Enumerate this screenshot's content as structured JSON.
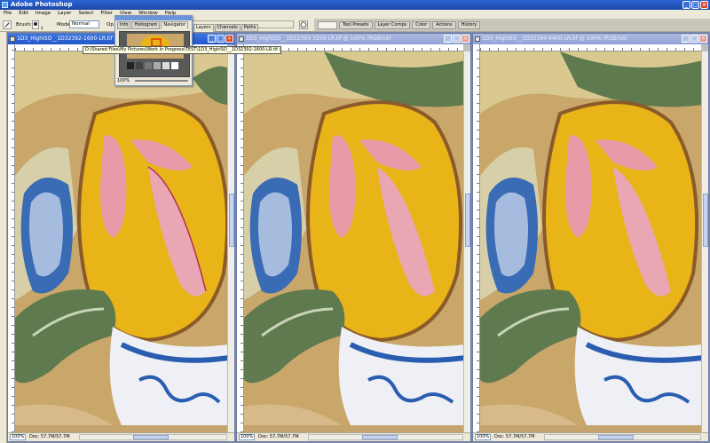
{
  "app": {
    "title": "Adobe Photoshop",
    "window_buttons": [
      "_",
      "□",
      "×"
    ]
  },
  "menu": [
    "File",
    "Edit",
    "Image",
    "Layer",
    "Select",
    "Filter",
    "View",
    "Window",
    "Help"
  ],
  "options_bar": {
    "brush_label": "Brush:",
    "brush_size": "4",
    "mode_label": "Mode:",
    "mode_value": "Normal",
    "opacity_label": "Op"
  },
  "palette_well": {
    "tabs": [
      "Tool Presets",
      "Layer Comps",
      "Color",
      "Actions",
      "History"
    ]
  },
  "layers_panel_tabs": [
    "Layers",
    "Channels",
    "Paths"
  ],
  "navigator": {
    "tabs": [
      "Info",
      "Histogram",
      "Navigator"
    ],
    "active_tab": "Navigator",
    "zoom": "100%"
  },
  "tooltip": "D:\\Shared Files\\My Pictures\\Work In Progress\\TEST\\1D3_HighISO__1D32392-1600-LR.tif @ 100% (RGB/16)",
  "documents": [
    {
      "title": "1D3_HighISO__1D32392-1600-LR.tif @ 1600%",
      "active": true,
      "zoom": "100%",
      "doc_size": "Doc: 57.7M/57.7M",
      "buttons": [
        "_",
        "□",
        "×"
      ]
    },
    {
      "title": "1D3_HighISO__1D32393-3200-LR.tif @ 100% (RGB/16)",
      "active": false,
      "zoom": "100%",
      "doc_size": "Doc: 57.7M/57.7M",
      "buttons": [
        "_",
        "□",
        "×"
      ]
    },
    {
      "title": "1D3_HighISO__1D32394-6400-LR.tif @ 100% (RGB/16)",
      "active": false,
      "zoom": "100%",
      "doc_size": "Doc: 57.7M/57.7M",
      "buttons": [
        "_",
        "□",
        "×"
      ]
    }
  ],
  "colors": {
    "title_active": "#2456c8",
    "title_inactive": "#90a3d6",
    "chrome": "#ece9d8",
    "workspace": "#7d8aa3",
    "painting_yellow": "#e8b417",
    "painting_cream": "#e2cf9a",
    "painting_blue": "#2a5db0",
    "painting_green": "#5f7a4f",
    "painting_pink": "#e89aa8"
  }
}
